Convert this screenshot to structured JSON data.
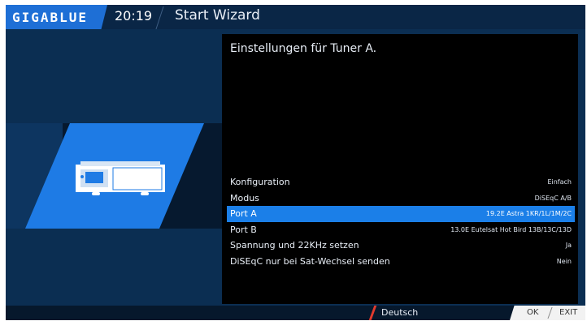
{
  "header": {
    "logo": "GIGABLUE",
    "clock": "20:19",
    "title": "Start Wizard"
  },
  "panel": {
    "title": "Einstellungen für Tuner A."
  },
  "settings": [
    {
      "label": "Konfiguration",
      "value": "Einfach"
    },
    {
      "label": "Modus",
      "value": "DiSEqC A/B"
    },
    {
      "label": "Port A",
      "value": "19.2E Astra 1KR/1L/1M/2C"
    },
    {
      "label": "Port B",
      "value": "13.0E Eutelsat Hot Bird 13B/13C/13D"
    },
    {
      "label": "Spannung und 22KHz setzen",
      "value": "Ja"
    },
    {
      "label": "DiSEqC nur bei Sat-Wechsel senden",
      "value": "Nein"
    }
  ],
  "selected_index": 2,
  "footer": {
    "language": "Deutsch",
    "ok_label": "OK",
    "exit_label": "EXIT"
  },
  "colors": {
    "accent": "#1b7fe8",
    "background": "#0b2e52",
    "panel": "#000000",
    "language_marker": "#e23b2e"
  },
  "icons": [
    "set-top-box-icon"
  ]
}
